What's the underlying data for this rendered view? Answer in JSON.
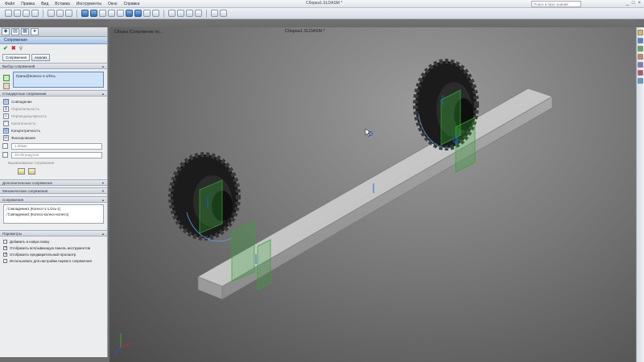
{
  "app": {
    "title": "Сборка1.SLDASM *",
    "menu": [
      "Файл",
      "Правка",
      "Вид",
      "Вставка",
      "Инструменты",
      "Окно",
      "Справка"
    ],
    "search_placeholder": "Поиск в базе знаний",
    "window_buttons": [
      "_",
      "□",
      "×"
    ]
  },
  "viewport": {
    "caption": "Сборка1.SLDASM *",
    "breadcrumb": "Сборка (Сопряжение по...",
    "background_colors": [
      "#9b9b9b",
      "#4a4a4a"
    ],
    "selection_color": "#1e5ad6",
    "mate_plane_color": "#2ea82e"
  },
  "panel": {
    "title": "Сопряжение",
    "mode_tabs": [
      "Сопряжения",
      "Анализ"
    ],
    "selection_group": {
      "header": "Выбор сопряжений",
      "item": "Грань@Колесо-1-1/Ось"
    },
    "standard_group": {
      "header": "Стандартные сопряжения",
      "items": [
        {
          "label": "Совпадение",
          "icon": "coincident-icon",
          "selected": true,
          "dim": false
        },
        {
          "label": "Параллельность",
          "icon": "parallel-icon",
          "selected": false,
          "dim": true
        },
        {
          "label": "Перпендикулярность",
          "icon": "perpendicular-icon",
          "selected": false,
          "dim": true
        },
        {
          "label": "Касательность",
          "icon": "tangent-icon",
          "selected": false,
          "dim": true
        },
        {
          "label": "Концентричность",
          "icon": "concentric-icon",
          "selected": true,
          "dim": false
        },
        {
          "label": "Фиксирование",
          "icon": "lock-icon",
          "selected": false,
          "dim": false
        }
      ],
      "distance_value": "1.00мм",
      "angle_value": "30.00градусов",
      "alignment_label": "Выравнивание сопряжения"
    },
    "advanced_header": "Дополнительные сопряжения",
    "mechanical_header": "Механические сопряжения",
    "mates_group": {
      "header": "Сопряжения",
      "items": [
        "Совпадение1 (Колесо-1-1,Ось-1)",
        "Совпадение2 (Колесо-колесо-колесо)"
      ]
    },
    "options_group": {
      "header": "Параметры",
      "checks": [
        {
          "label": "Добавить в новую папку",
          "checked": false
        },
        {
          "label": "Отобразить всплывающую панель инструментов",
          "checked": true
        },
        {
          "label": "Отобразить предварительный просмотр",
          "checked": true
        },
        {
          "label": "Использовать для настройки первого сопряжения",
          "checked": false
        }
      ]
    }
  },
  "taskpane": {
    "icons": [
      "home-icon",
      "library-icon",
      "explorer-icon",
      "search-icon",
      "view-palette-icon",
      "appearances-icon",
      "custom-properties-icon"
    ],
    "colors": [
      "#e8b43a",
      "#4c86d1",
      "#6aa84f",
      "#d9863a",
      "#8f6fc7",
      "#c94f4f",
      "#4fa3c9"
    ]
  }
}
